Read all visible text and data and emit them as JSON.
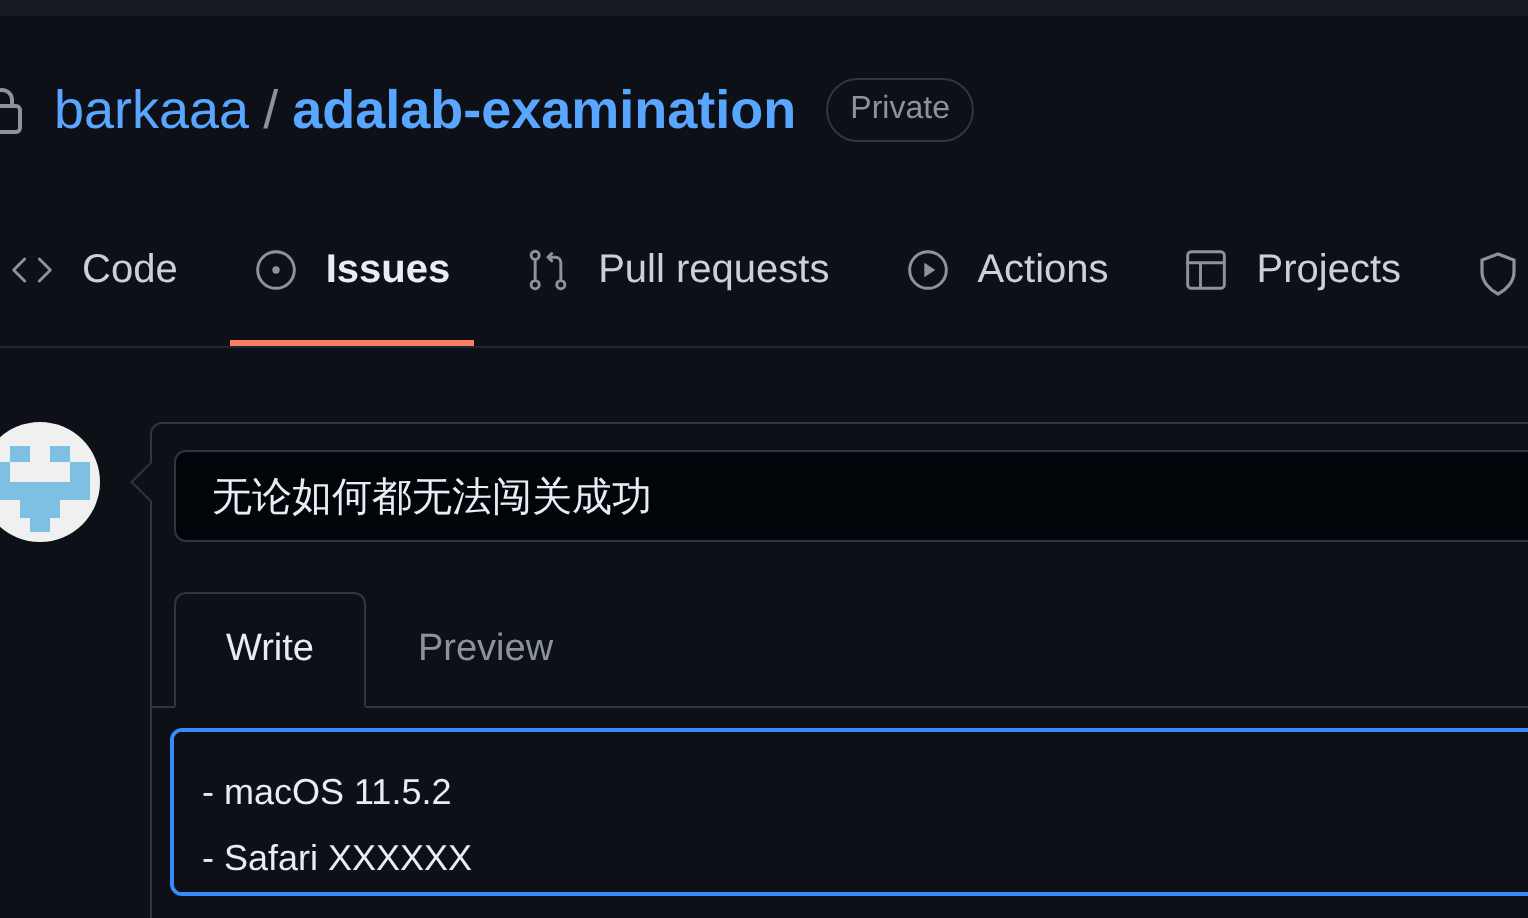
{
  "repo": {
    "owner": "barkaaa",
    "separator": "/",
    "name": "adalab-examination",
    "visibility": "Private"
  },
  "tabs": [
    {
      "label": "Code",
      "selected": false
    },
    {
      "label": "Issues",
      "selected": true
    },
    {
      "label": "Pull requests",
      "selected": false
    },
    {
      "label": "Actions",
      "selected": false
    },
    {
      "label": "Projects",
      "selected": false
    }
  ],
  "issue_form": {
    "title": {
      "value": "无论如何都无法闯关成功"
    },
    "editor_tabs": [
      {
        "label": "Write",
        "selected": true
      },
      {
        "label": "Preview",
        "selected": false
      }
    ],
    "body": {
      "value": "- macOS 11.5.2\n- Safari XXXXXX"
    }
  }
}
